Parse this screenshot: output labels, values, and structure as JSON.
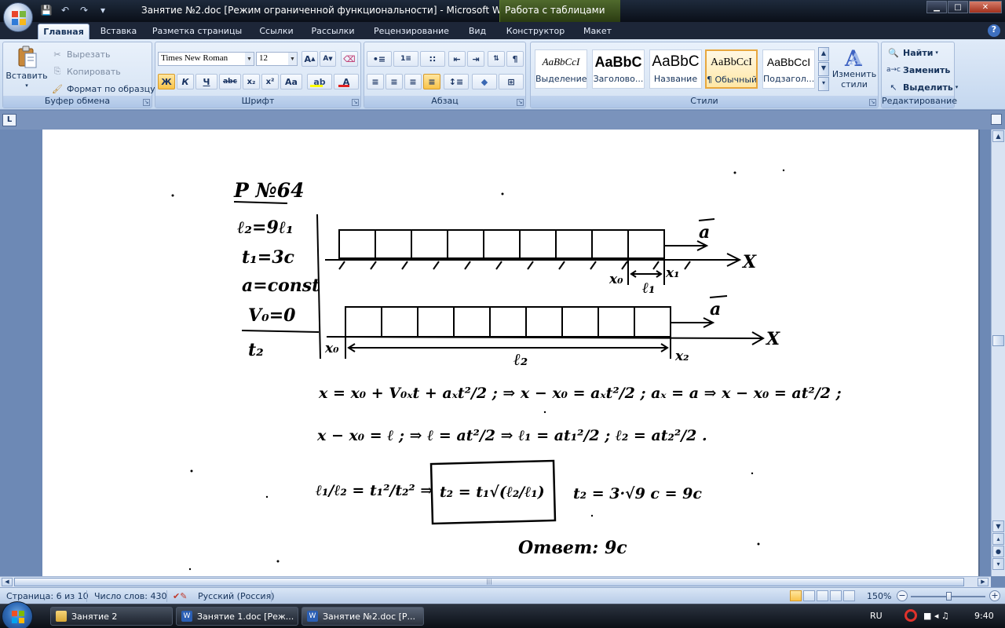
{
  "window": {
    "title": "Занятие №2.doc [Режим ограниченной функциональности] - Microsoft Wo...",
    "contextual_tab_title": "Работа с таблицами",
    "buttons": [
      "minimize",
      "maximize",
      "close"
    ]
  },
  "tabs": [
    {
      "label": "Главная",
      "active": true
    },
    {
      "label": "Вставка"
    },
    {
      "label": "Разметка страницы"
    },
    {
      "label": "Ссылки"
    },
    {
      "label": "Рассылки"
    },
    {
      "label": "Рецензирование"
    },
    {
      "label": "Вид"
    },
    {
      "label": "Конструктор"
    },
    {
      "label": "Макет"
    }
  ],
  "ribbon": {
    "clipboard": {
      "label": "Буфер обмена",
      "paste": "Вставить",
      "cut": "Вырезать",
      "copy": "Копировать",
      "format_painter": "Формат по образцу"
    },
    "font": {
      "label": "Шрифт",
      "font_name": "Times New Roman",
      "font_size": "12",
      "bold": "Ж",
      "italic": "К",
      "underline": "Ч",
      "strike": "abc",
      "subscript": "x₂",
      "superscript": "x²",
      "change_case": "Aa",
      "grow": "A",
      "shrink": "A"
    },
    "paragraph": {
      "label": "Абзац"
    },
    "styles": {
      "label": "Стили",
      "items": [
        {
          "sample": "AaBbCcI",
          "name": "Выделение"
        },
        {
          "sample": "AaBbC",
          "name": "Заголово..."
        },
        {
          "sample": "AaBbC",
          "name": "Название"
        },
        {
          "sample": "AaBbCcI",
          "name": "¶ Обычный",
          "selected": true
        },
        {
          "sample": "AaBbCcI",
          "name": "Подзагол..."
        }
      ],
      "change_styles_line1": "Изменить",
      "change_styles_line2": "стили"
    },
    "editing": {
      "label": "Редактирование",
      "find": "Найти",
      "replace": "Заменить",
      "select": "Выделить"
    }
  },
  "document": {
    "ruler_corner": "L",
    "handwriting": {
      "header": "Р №64",
      "given": [
        "ℓ₂=9ℓ₁",
        "t₁=3с",
        "a=const",
        "V₀=0",
        "t₂"
      ],
      "diagram_labels": {
        "axis": "X",
        "accel": "a",
        "x0": "x₀",
        "x1": "x₁",
        "x2": "x₂",
        "l1": "ℓ₁",
        "l2": "ℓ₂"
      },
      "line1": "x = x₀ + V₀ₓt + aₓt²/2 ;  ⇒  x − x₀ = aₓt²/2 ;  aₓ = a  ⇒  x − x₀ = at²/2 ;",
      "line2": "x − x₀ = ℓ ;  ⇒  ℓ = at²/2  ⇒  ℓ₁ = at₁²/2 ;  ℓ₂ = at₂²/2 .",
      "line3_left": "ℓ₁/ℓ₂ = t₁²/t₂²  ⇒",
      "line3_box": "t₂ = t₁√(ℓ₂/ℓ₁)",
      "line3_right": "t₂ = 3·√9 с = 9с",
      "answer": "Ответ: 9с"
    }
  },
  "statusbar": {
    "page": "Страница: 6 из 10",
    "words": "Число слов: 430",
    "language": "Русский (Россия)",
    "zoom": "150%",
    "zoom_level": 0.52
  },
  "taskbar": {
    "items": [
      "Занятие 2",
      "Занятие 1.doc [Реж...",
      "Занятие №2.doc [Р..."
    ],
    "lang": "RU",
    "time": "9:40"
  },
  "colors": {
    "ribbon_bg": "#c4d7ef",
    "doc_bg": "#6d89b5",
    "highlight": "#f8c34a",
    "ink": "#000000"
  }
}
